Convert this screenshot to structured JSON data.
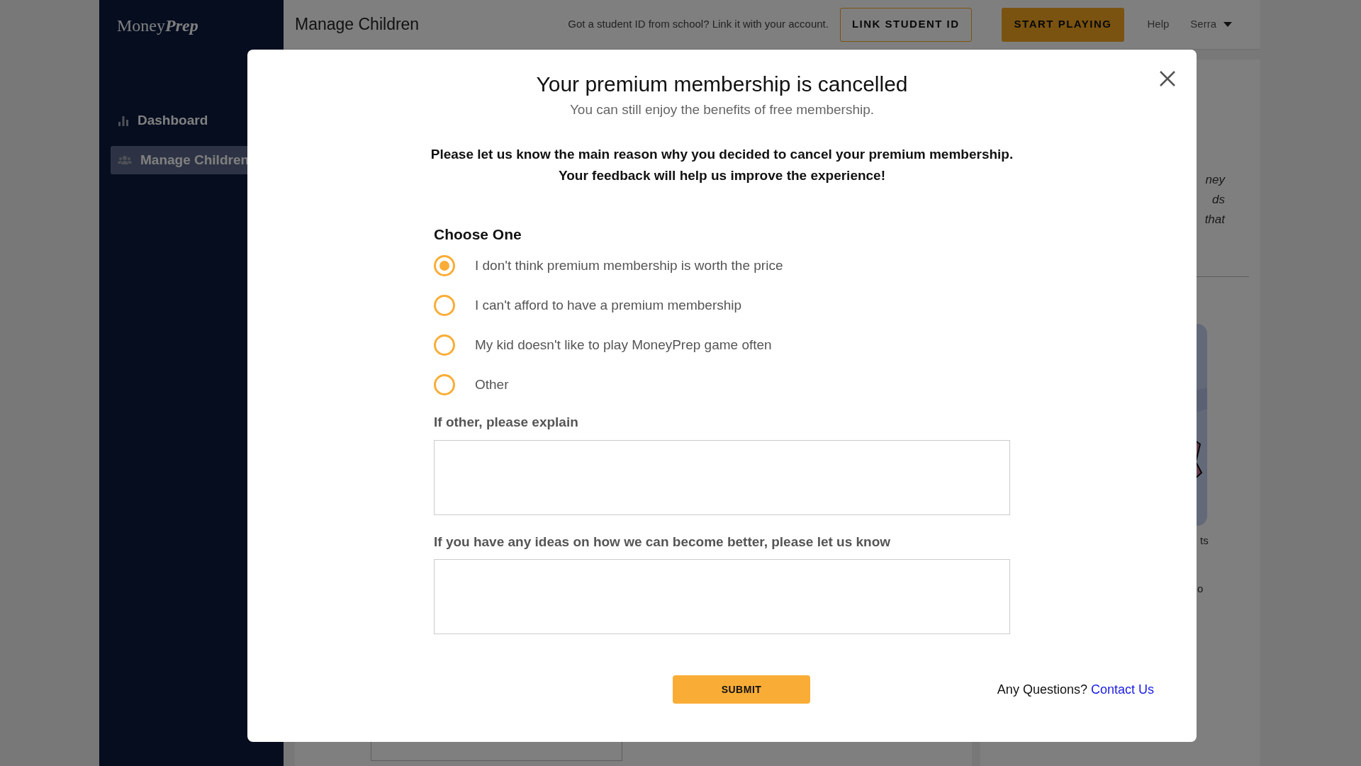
{
  "sidebar": {
    "logo": {
      "plain": "Money",
      "italic": "Prep"
    },
    "items": [
      {
        "label": "Dashboard",
        "kind": "chart",
        "selected": false
      },
      {
        "label": "Manage Children",
        "kind": "users",
        "selected": true
      }
    ]
  },
  "header": {
    "title": "Manage Children",
    "hint": "Got a student ID from school? Link it with your account.",
    "link_button": "LINK STUDENT ID",
    "play_button": "START PLAYING",
    "help": "Help",
    "user": "Serra"
  },
  "background_fragments": [
    "ney",
    "ds",
    "that",
    "ts",
    "o"
  ],
  "modal": {
    "title": "Your premium membership is cancelled",
    "subtitle": "You can still enjoy the benefits of free membership.",
    "prompt": [
      "Please let us know the main reason why you decided to cancel your premium membership.",
      "Your feedback will help us improve the experience!"
    ],
    "choose_label": "Choose One",
    "options": [
      {
        "label": "I don't think premium membership is worth the price",
        "selected": true
      },
      {
        "label": "I can't afford to have a premium membership",
        "selected": false
      },
      {
        "label": "My kid doesn't like to play MoneyPrep game often",
        "selected": false
      },
      {
        "label": "Other",
        "selected": false
      }
    ],
    "fields": [
      {
        "label": "If other, please explain"
      },
      {
        "label": "If you have any ideas on how we can become better, please let us know"
      }
    ],
    "submit": "SUBMIT",
    "questions": "Any Questions?",
    "contact_link": "Contact Us"
  }
}
